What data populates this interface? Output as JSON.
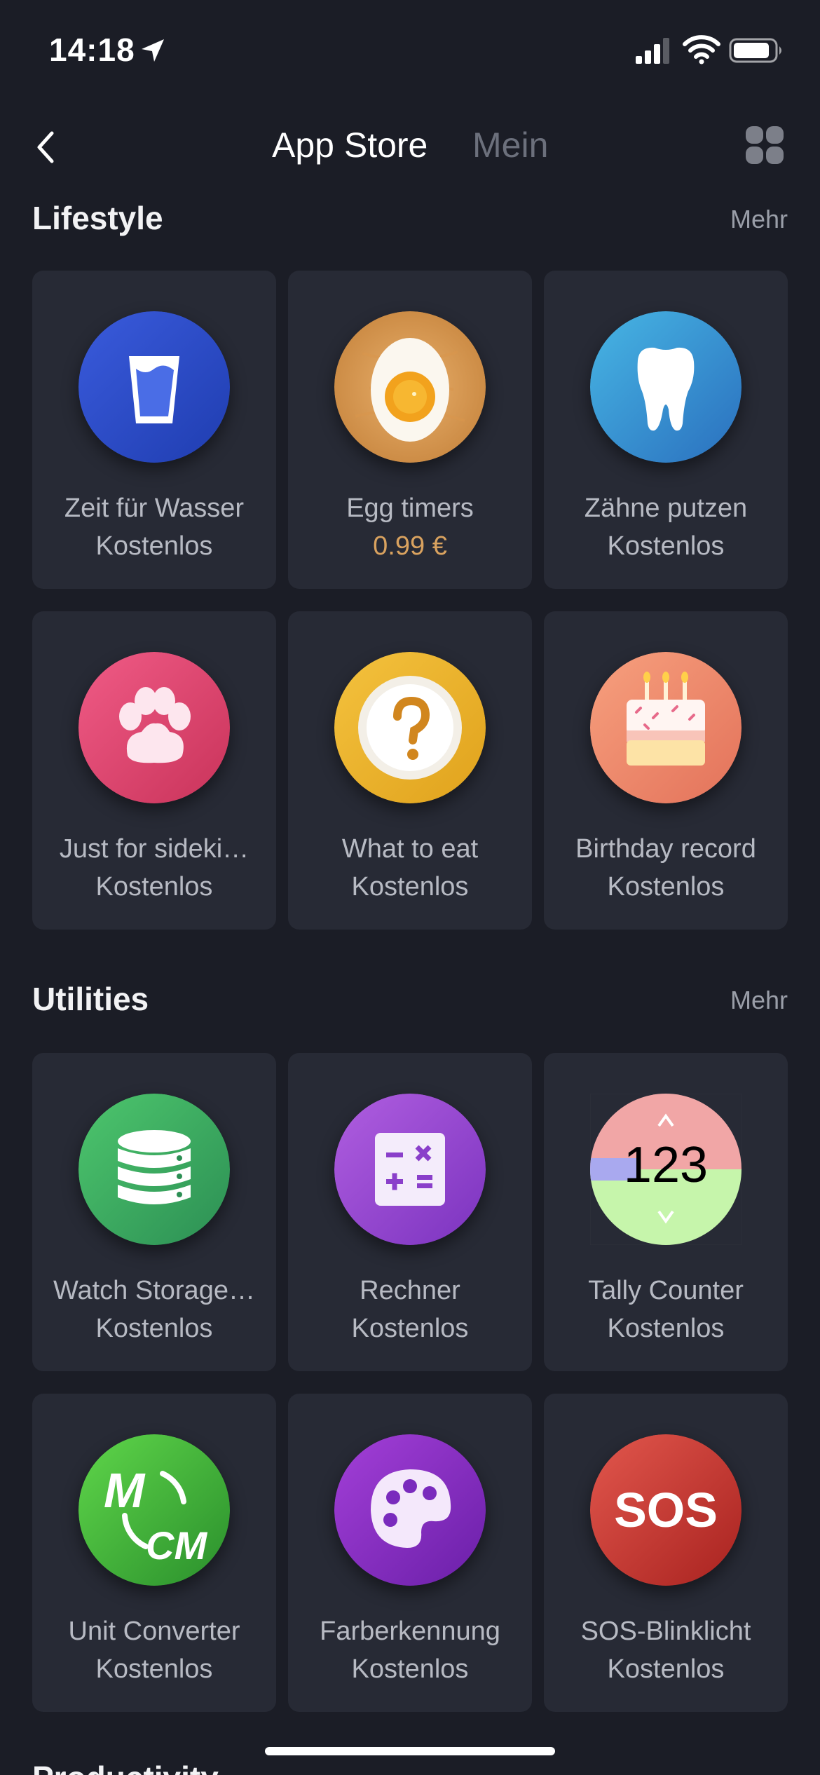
{
  "status": {
    "time": "14:18"
  },
  "nav": {
    "tab_active": "App Store",
    "tab_inactive": "Mein"
  },
  "sections": [
    {
      "title": "Lifestyle",
      "more": "Mehr",
      "apps": [
        {
          "name": "Zeit für Wasser",
          "price": "Kostenlos",
          "icon": "water-glass-icon"
        },
        {
          "name": "Egg timers",
          "price": "0.99 €",
          "icon": "egg-icon"
        },
        {
          "name": "Zähne putzen",
          "price": "Kostenlos",
          "icon": "tooth-icon"
        },
        {
          "name": "Just for sideki…",
          "price": "Kostenlos",
          "icon": "paw-icon"
        },
        {
          "name": "What to eat",
          "price": "Kostenlos",
          "icon": "question-plate-icon"
        },
        {
          "name": "Birthday record",
          "price": "Kostenlos",
          "icon": "birthday-cake-icon"
        }
      ]
    },
    {
      "title": "Utilities",
      "more": "Mehr",
      "apps": [
        {
          "name": "Watch Storage…",
          "price": "Kostenlos",
          "icon": "database-icon"
        },
        {
          "name": "Rechner",
          "price": "Kostenlos",
          "icon": "calculator-icon"
        },
        {
          "name": "Tally Counter",
          "price": "Kostenlos",
          "icon": "tally-counter-icon",
          "icon_text": "123"
        },
        {
          "name": "Unit Converter",
          "price": "Kostenlos",
          "icon": "unit-converter-icon",
          "icon_text_top": "M",
          "icon_text_bottom": "CM"
        },
        {
          "name": "Farberkennung",
          "price": "Kostenlos",
          "icon": "palette-icon"
        },
        {
          "name": "SOS-Blinklicht",
          "price": "Kostenlos",
          "icon": "sos-icon",
          "icon_text": "SOS"
        }
      ]
    }
  ],
  "next_section_title": "Productivity",
  "colors": {
    "background": "#1b1d26",
    "card": "#272a35",
    "paid_price": "#d9a25f"
  }
}
